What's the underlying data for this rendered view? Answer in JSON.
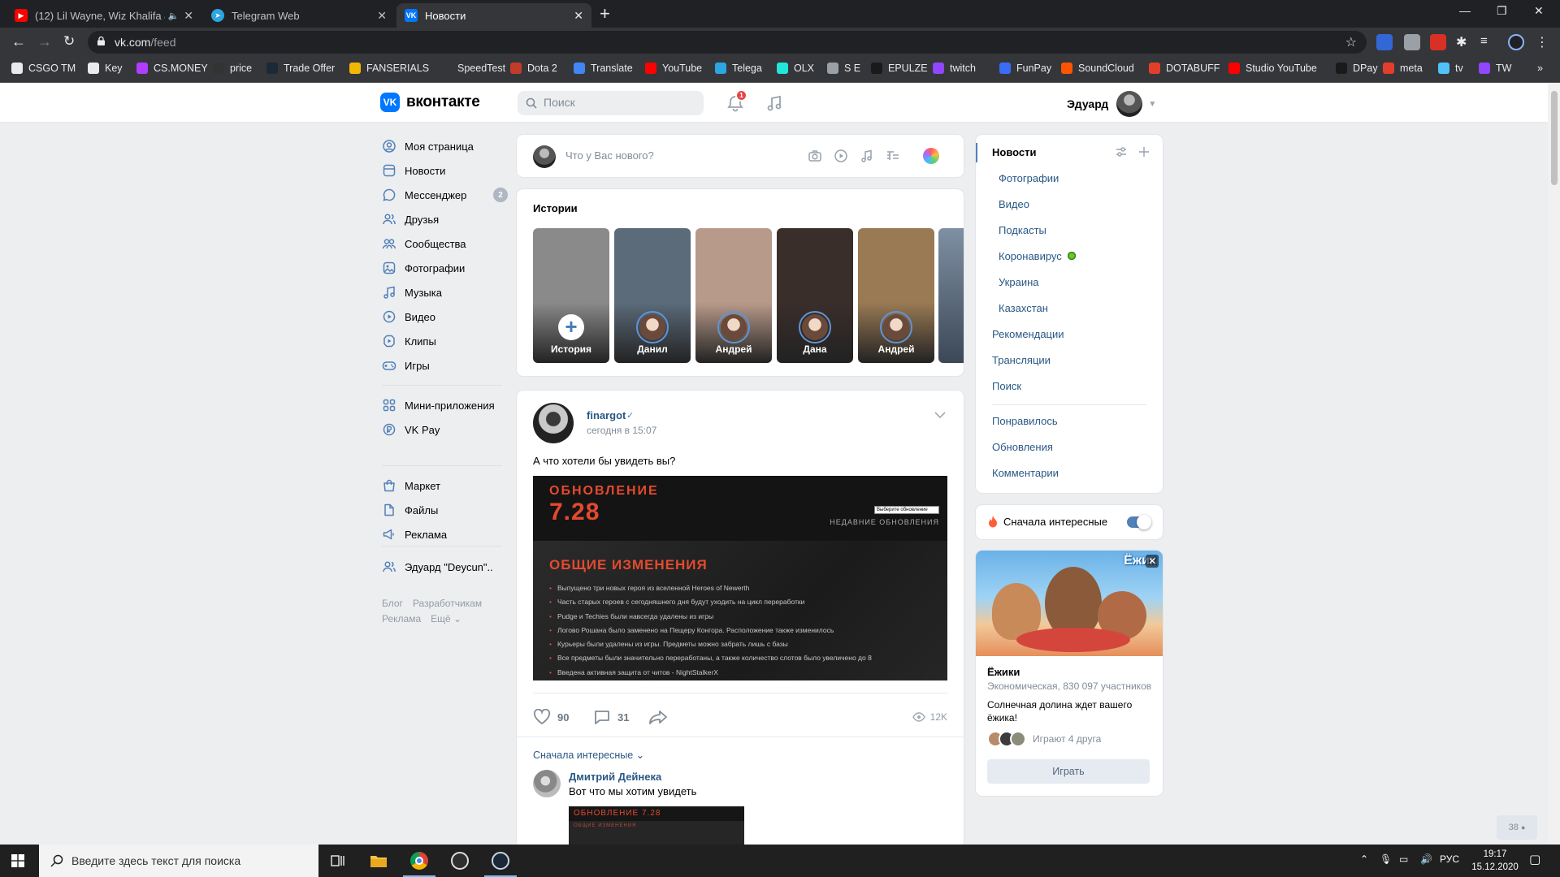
{
  "browser": {
    "tabs": [
      {
        "title": "(12) Lil Wayne, Wiz Khalifa &",
        "color": "#ff0000",
        "active": false
      },
      {
        "title": "Telegram Web",
        "color": "#2ca5e0",
        "active": false
      },
      {
        "title": "Новости",
        "color": "#0077ff",
        "active": true
      }
    ],
    "url_host": "vk.com",
    "url_path": "/feed",
    "bookmarks": [
      {
        "label": "CSGO TM",
        "color": "#e8eaed"
      },
      {
        "label": "Key",
        "color": "#e8eaed"
      },
      {
        "label": "CS.MONEY",
        "color": "#b03dff"
      },
      {
        "label": "price",
        "color": "#333333"
      },
      {
        "label": "Trade Offer",
        "color": "#1b2838"
      },
      {
        "label": "FANSERIALS",
        "color": "#f2b705"
      },
      {
        "label": "SpeedTest",
        "color": "#35363a"
      },
      {
        "label": "Dota 2",
        "color": "#c23c2a"
      },
      {
        "label": "Translate",
        "color": "#4285f4"
      },
      {
        "label": "YouTube",
        "color": "#ff0000"
      },
      {
        "label": "Telega",
        "color": "#2ca5e0"
      },
      {
        "label": "OLX",
        "color": "#23e5db"
      },
      {
        "label": "S E",
        "color": "#9aa0a6"
      },
      {
        "label": "EPULZE",
        "color": "#1a1a1a"
      },
      {
        "label": "twitch",
        "color": "#9146ff"
      },
      {
        "label": "FunPay",
        "color": "#3b6cf6"
      },
      {
        "label": "SoundCloud",
        "color": "#ff5500"
      },
      {
        "label": "DOTABUFF",
        "color": "#e33e2b"
      },
      {
        "label": "Studio YouTube",
        "color": "#ff0000"
      },
      {
        "label": "DPay",
        "color": "#1a1a1a"
      },
      {
        "label": "meta",
        "color": "#e33e2b"
      },
      {
        "label": "tv",
        "color": "#4fc3f7"
      },
      {
        "label": "TW",
        "color": "#9146ff"
      }
    ]
  },
  "vk": {
    "logo_text": "вконтакте",
    "search_placeholder": "Поиск",
    "notifications_count": "1",
    "user_name": "Эдуард"
  },
  "left_menu": {
    "items": [
      {
        "label": "Моя страница",
        "icon": "profile-icon"
      },
      {
        "label": "Новости",
        "icon": "news-icon"
      },
      {
        "label": "Мессенджер",
        "icon": "messenger-icon",
        "count": "2"
      },
      {
        "label": "Друзья",
        "icon": "friends-icon"
      },
      {
        "label": "Сообщества",
        "icon": "communities-icon"
      },
      {
        "label": "Фотографии",
        "icon": "photos-icon"
      },
      {
        "label": "Музыка",
        "icon": "music-icon"
      },
      {
        "label": "Видео",
        "icon": "video-icon"
      },
      {
        "label": "Клипы",
        "icon": "clips-icon"
      },
      {
        "label": "Игры",
        "icon": "games-icon"
      }
    ],
    "items2": [
      {
        "label": "Мини-приложения",
        "icon": "mini-apps-icon"
      },
      {
        "label": "VK Pay",
        "icon": "vk-pay-icon"
      }
    ],
    "items3": [
      {
        "label": "Маркет",
        "icon": "market-icon"
      },
      {
        "label": "Файлы",
        "icon": "files-icon"
      },
      {
        "label": "Реклама",
        "icon": "ads-icon"
      }
    ],
    "items4": [
      {
        "label": "Эдуард \"Deycun\"..",
        "icon": "group-icon"
      }
    ],
    "footer": {
      "blog": "Блог",
      "devs": "Разработчикам",
      "ads": "Реклама",
      "more": "Ещё ⌄"
    }
  },
  "composer": {
    "placeholder": "Что у Вас нового?"
  },
  "stories": {
    "title": "Истории",
    "items": [
      {
        "name": "История",
        "bg": "#8a8a8a"
      },
      {
        "name": "Данил",
        "bg": "#5b6b7a"
      },
      {
        "name": "Андрей",
        "bg": "#b89a8a"
      },
      {
        "name": "Дана",
        "bg": "#3a2e2a"
      },
      {
        "name": "Андрей",
        "bg": "#9a7a54"
      }
    ]
  },
  "post": {
    "author": "finargot",
    "verified": "✓",
    "date": "сегодня в 15:07",
    "text": "А что хотели бы увидеть вы?",
    "image": {
      "heading": "ОБНОВЛЕНИЕ",
      "version": "7.28",
      "select": "Выберите обновление",
      "recent": "НЕДАВНИЕ ОБНОВЛЕНИЯ",
      "section": "ОБЩИЕ ИЗМЕНЕНИЯ",
      "bullets": [
        "Выпущено три новых героя из вселенной Heroes of Newerth",
        "Часть старых героев с сегодняшнего дня будут уходить на цикл переработки",
        "Pudge и Techies были навсегда удалены из игры",
        "Логово Рошана было заменено на Пещеру Конгора. Расположение также изменилось",
        "Курьеры были удалены из игры. Предметы можно забрать лишь с базы",
        "Все предметы были значительно переработаны, а также количество слотов было увеличено до 8",
        "Введена активная защита от читов - NightStalkerX"
      ]
    },
    "likes": "90",
    "comments": "31",
    "views": "12K",
    "sort_label": "Сначала интересные ⌄",
    "comment": {
      "author": "Дмитрий Дейнека",
      "text": "Вот что мы хотим увидеть",
      "image_caption": "ОБНОВЛЕНИЕ 7.28",
      "image_sub": "ОБЩИЕ ИЗМЕНЕНИЯ"
    }
  },
  "right_menu": {
    "active": "Новости",
    "subitems": [
      "Фотографии",
      "Видео",
      "Подкасты",
      "Коронавирус",
      "Украина",
      "Казахстан"
    ],
    "items": [
      "Рекомендации",
      "Трансляции",
      "Поиск"
    ],
    "items2": [
      "Понравилось",
      "Обновления",
      "Комментарии"
    ]
  },
  "interesting_toggle": {
    "label": "Сначала интересные"
  },
  "ad": {
    "art_logo": "Ёжик",
    "title": "Ёжики",
    "meta": "Экономическая, 830 097 участников",
    "description": "Солнечная долина ждет вашего ёжика!",
    "friends_text": "Играют 4 друга",
    "button": "Играть"
  },
  "online_count": "38",
  "taskbar": {
    "search_placeholder": "Введите здесь текст для поиска",
    "lang": "РУС",
    "time": "19:17",
    "date": "15.12.2020"
  }
}
